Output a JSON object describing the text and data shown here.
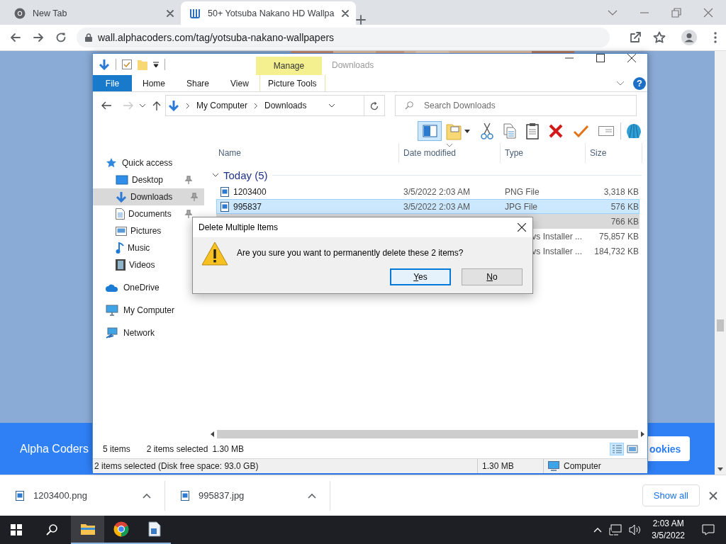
{
  "browser": {
    "tabs": [
      {
        "title": "New Tab",
        "kind": "newtab",
        "selected": false
      },
      {
        "title": "50+ Yotsuba Nakano HD Wallpa",
        "kind": "site",
        "selected": true
      }
    ],
    "url": "wall.alphacoders.com/tag/yotsuba-nakano-wallpapers"
  },
  "page": {
    "brand": "Alpha Coders",
    "cookie_button": "ookies"
  },
  "explorer": {
    "context_tab": "Manage",
    "title": "Downloads",
    "help": "?",
    "ribbon_tabs": [
      {
        "label": "File",
        "kind": "file"
      },
      {
        "label": "Home",
        "kind": "tab"
      },
      {
        "label": "Share",
        "kind": "tab"
      },
      {
        "label": "View",
        "kind": "tab"
      },
      {
        "label": "Picture Tools",
        "kind": "context"
      }
    ],
    "breadcrumb": [
      "My Computer",
      "Downloads"
    ],
    "search": {
      "placeholder": "Search Downloads"
    },
    "preview_pane": true,
    "sidebar": [
      {
        "label": "Quick access",
        "selected": false,
        "children": [
          {
            "label": "Desktop",
            "pinned": true,
            "selected": false
          },
          {
            "label": "Downloads",
            "pinned": true,
            "selected": true
          },
          {
            "label": "Documents",
            "pinned": true,
            "selected": false
          },
          {
            "label": "Pictures",
            "pinned": false,
            "selected": false
          },
          {
            "label": "Music",
            "pinned": false,
            "selected": false
          },
          {
            "label": "Videos",
            "pinned": false,
            "selected": false
          }
        ]
      },
      {
        "label": "OneDrive",
        "selected": false
      },
      {
        "label": "My Computer",
        "selected": false
      },
      {
        "label": "Network",
        "selected": false
      }
    ],
    "columns": [
      "Name",
      "Date modified",
      "Type",
      "Size"
    ],
    "group": "Today (5)",
    "rows": [
      {
        "kind": "full",
        "name": "1203400",
        "date": "3/5/2022 2:03 AM",
        "type": "PNG File",
        "size": "3,318 KB",
        "selected": false,
        "focused": false
      },
      {
        "kind": "full",
        "name": "995837",
        "date": "3/5/2022 2:03 AM",
        "type": "JPG File",
        "size": "576 KB",
        "selected": true,
        "focused": true
      },
      {
        "kind": "covered",
        "size": "766 KB",
        "selected": true,
        "focused": false
      },
      {
        "kind": "covered",
        "type": "vs Installer ...",
        "size": "75,857 KB",
        "selected": false,
        "focused": false
      },
      {
        "kind": "covered",
        "type": "vs Installer ...",
        "size": "184,732 KB",
        "selected": false,
        "focused": false
      }
    ],
    "status": {
      "count": "5 items",
      "selection": "2 items selected",
      "size": "1.30 MB"
    },
    "views": [
      {
        "selected": true
      },
      {
        "selected": false
      }
    ],
    "status_bar": {
      "info": "2 items selected (Disk free space: 93.0 GB)",
      "size": "1.30 MB",
      "zone": "Computer"
    }
  },
  "dialog": {
    "title": "Delete Multiple Items",
    "message": "Are you sure you want to permanently delete these 2 items?",
    "buttons": [
      {
        "label": "Yes",
        "selected": true
      },
      {
        "label": "No",
        "selected": false
      }
    ]
  },
  "downloads": {
    "items": [
      {
        "name": "1203400.png"
      },
      {
        "name": "995837.jpg"
      }
    ],
    "show_all": "Show all"
  },
  "taskbar": {
    "apps": [
      {
        "selected": true
      },
      {
        "selected": false
      },
      {
        "selected": false
      }
    ],
    "time": "2:03 AM",
    "date": "3/5/2022"
  }
}
